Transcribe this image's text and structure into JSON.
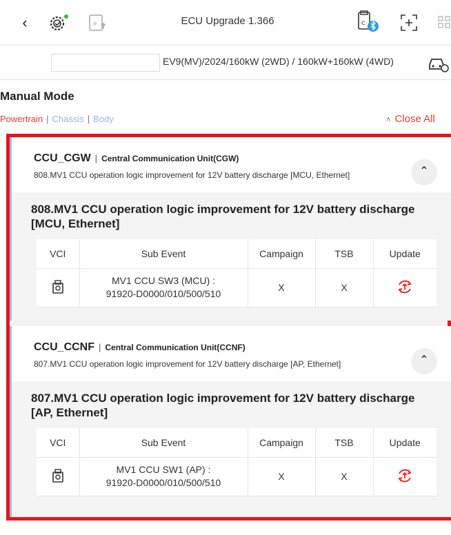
{
  "header": {
    "title": "ECU Upgrade 1.366",
    "icons": {
      "back": "chevron-left-icon",
      "gear_check": "gear-check-icon",
      "ecu_upload": "ecu-upload-icon",
      "vci_bluetooth": "vci-bluetooth-icon",
      "scan_add": "scan-add-icon",
      "grid": "grid-icon"
    }
  },
  "vehicle": {
    "vin_value": "",
    "model": "EV9(MV)/2024/160kW (2WD) / 160kW+160kW (4WD)"
  },
  "mode": {
    "title": "Manual Mode",
    "tabs": [
      {
        "label": "Powertrain",
        "active": true
      },
      {
        "label": "Chassis",
        "active": false
      },
      {
        "label": "Body",
        "active": false
      }
    ],
    "separator": "|",
    "close_all_label": "Close All",
    "close_all_icon": "double-chevron-up-icon"
  },
  "colors": {
    "accent_red": "#d9402b",
    "highlight_border": "#e8141c",
    "card_left_border": "#8fc5e3",
    "inactive_tab": "#9ab7d6"
  },
  "table_headers": {
    "vci": "VCI",
    "sub_event": "Sub Event",
    "campaign": "Campaign",
    "tsb": "TSB",
    "update": "Update"
  },
  "cards": [
    {
      "code": "CCU_CGW",
      "name": "Central Communication Unit(CGW)",
      "subtitle": "808.MV1 CCU operation logic improvement for 12V battery discharge [MCU, Ethernet]",
      "event_title": "808.MV1 CCU operation logic improvement for 12V battery discharge [MCU, Ethernet]",
      "rows": [
        {
          "sub_event_line1": "MV1 CCU SW3 (MCU) :",
          "sub_event_line2": "91920-D0000/010/500/510",
          "campaign": "X",
          "tsb": "X"
        }
      ]
    },
    {
      "code": "CCU_CCNF",
      "name": "Central Communication Unit(CCNF)",
      "subtitle": "807.MV1 CCU operation logic improvement for 12V battery discharge [AP, Ethernet]",
      "event_title": "807.MV1 CCU operation logic improvement for 12V battery discharge [AP, Ethernet]",
      "rows": [
        {
          "sub_event_line1": "MV1 CCU SW1 (AP) :",
          "sub_event_line2": "91920-D0000/010/500/510",
          "campaign": "X",
          "tsb": "X"
        }
      ]
    }
  ]
}
